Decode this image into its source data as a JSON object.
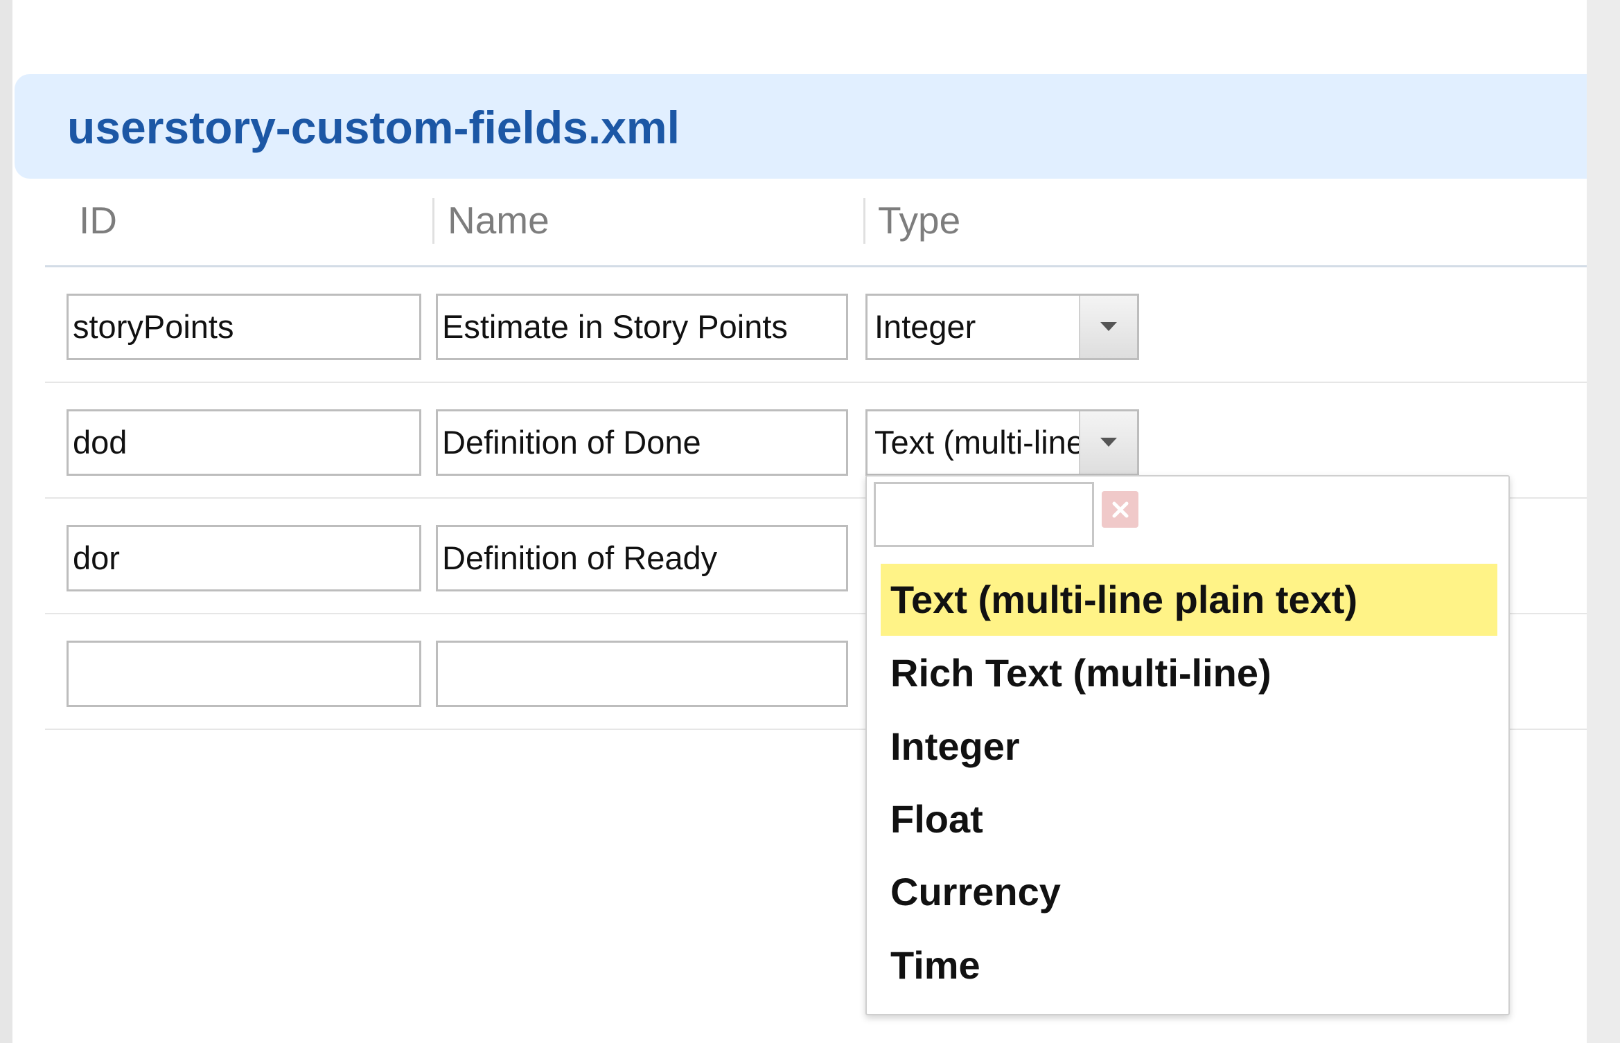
{
  "panel": {
    "title": "userstory-custom-fields.xml"
  },
  "columns": {
    "id": "ID",
    "name": "Name",
    "type": "Type"
  },
  "rows": [
    {
      "id": "storyPoints",
      "name": "Estimate in Story Points",
      "type": "Integer"
    },
    {
      "id": "dod",
      "name": "Definition of Done",
      "type": "Text (multi-line"
    },
    {
      "id": "dor",
      "name": "Definition of Ready",
      "type": ""
    },
    {
      "id": "",
      "name": "",
      "type": ""
    }
  ],
  "type_dropdown": {
    "search_value": "",
    "options": [
      {
        "label": "Text (multi-line plain text)",
        "highlighted": true
      },
      {
        "label": "Rich Text (multi-line)",
        "highlighted": false
      },
      {
        "label": "Integer",
        "highlighted": false
      },
      {
        "label": "Float",
        "highlighted": false
      },
      {
        "label": "Currency",
        "highlighted": false
      },
      {
        "label": "Time",
        "highlighted": false
      }
    ]
  },
  "colors": {
    "title": "#1c57a5",
    "title_bar_bg": "#e1efff",
    "highlight": "#fff387"
  },
  "icons": {
    "select_toggle": "triangle-down-icon",
    "clear": "close-icon"
  }
}
